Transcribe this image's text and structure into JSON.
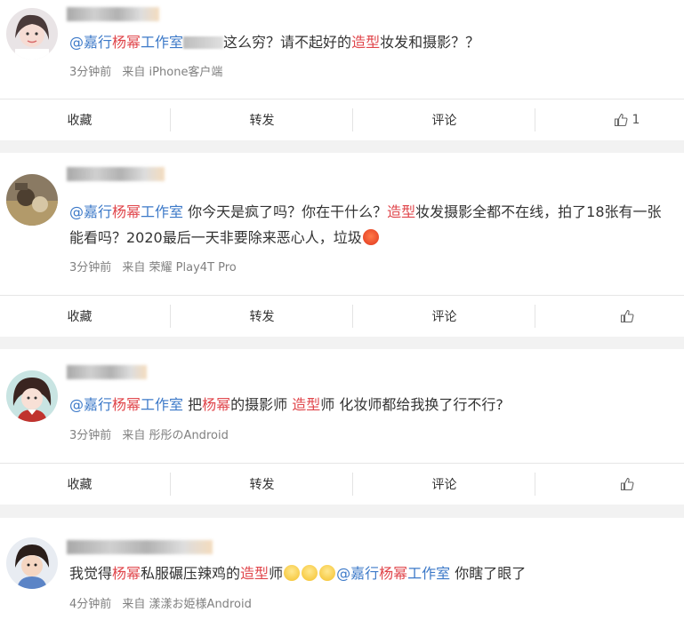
{
  "posts": [
    {
      "parts": [
        {
          "text": "@嘉行",
          "cls": "mention"
        },
        {
          "text": "杨幂",
          "cls": "hl"
        },
        {
          "text": "工作室",
          "cls": "mention"
        },
        {
          "text": "",
          "cls": "blur"
        },
        {
          "text": "这么穷？请不起好的",
          "cls": ""
        },
        {
          "text": "造型",
          "cls": "hl"
        },
        {
          "text": "妆发和摄影？？",
          "cls": ""
        }
      ],
      "time": "3分钟前",
      "source": "来自 iPhone客户端",
      "actions": {
        "collect": "收藏",
        "repost": "转发",
        "comment": "评论",
        "likes": "1"
      }
    },
    {
      "parts": [
        {
          "text": "@嘉行",
          "cls": "mention"
        },
        {
          "text": "杨幂",
          "cls": "hl"
        },
        {
          "text": "工作室",
          "cls": "mention"
        },
        {
          "text": " 你今天是疯了吗？你在干什么？",
          "cls": ""
        },
        {
          "text": "造型",
          "cls": "hl"
        },
        {
          "text": "妆发摄影全都不在线，拍了18张有一张能看吗？2020最后一天非要除来恶心人，垃圾",
          "cls": ""
        },
        {
          "text": "",
          "cls": "emoji-angry"
        }
      ],
      "time": "3分钟前",
      "source": "来自 荣耀 Play4T Pro",
      "actions": {
        "collect": "收藏",
        "repost": "转发",
        "comment": "评论",
        "likes": ""
      }
    },
    {
      "parts": [
        {
          "text": "@嘉行",
          "cls": "mention"
        },
        {
          "text": "杨幂",
          "cls": "hl"
        },
        {
          "text": "工作室",
          "cls": "mention"
        },
        {
          "text": " 把",
          "cls": ""
        },
        {
          "text": "杨幂",
          "cls": "hl"
        },
        {
          "text": "的摄影师 ",
          "cls": ""
        },
        {
          "text": "造型",
          "cls": "hl"
        },
        {
          "text": "师 化妆师都给我换了行不行?",
          "cls": ""
        }
      ],
      "time": "3分钟前",
      "source": "来自 彤彤のAndroid",
      "actions": {
        "collect": "收藏",
        "repost": "转发",
        "comment": "评论",
        "likes": ""
      }
    },
    {
      "parts": [
        {
          "text": "我觉得",
          "cls": ""
        },
        {
          "text": "杨幂",
          "cls": "hl"
        },
        {
          "text": "私服碾压辣鸡的",
          "cls": ""
        },
        {
          "text": "造型",
          "cls": "hl"
        },
        {
          "text": "师",
          "cls": ""
        },
        {
          "text": "",
          "cls": "emoji-drool"
        },
        {
          "text": "",
          "cls": "emoji-drool"
        },
        {
          "text": "",
          "cls": "emoji-drool"
        },
        {
          "text": "@嘉行",
          "cls": "mention"
        },
        {
          "text": "杨幂",
          "cls": "hl"
        },
        {
          "text": "工作室",
          "cls": "mention"
        },
        {
          "text": " 你瞎了眼了",
          "cls": ""
        }
      ],
      "time": "4分钟前",
      "source": "来自 漾漾お姫様Android",
      "actions": null
    }
  ]
}
